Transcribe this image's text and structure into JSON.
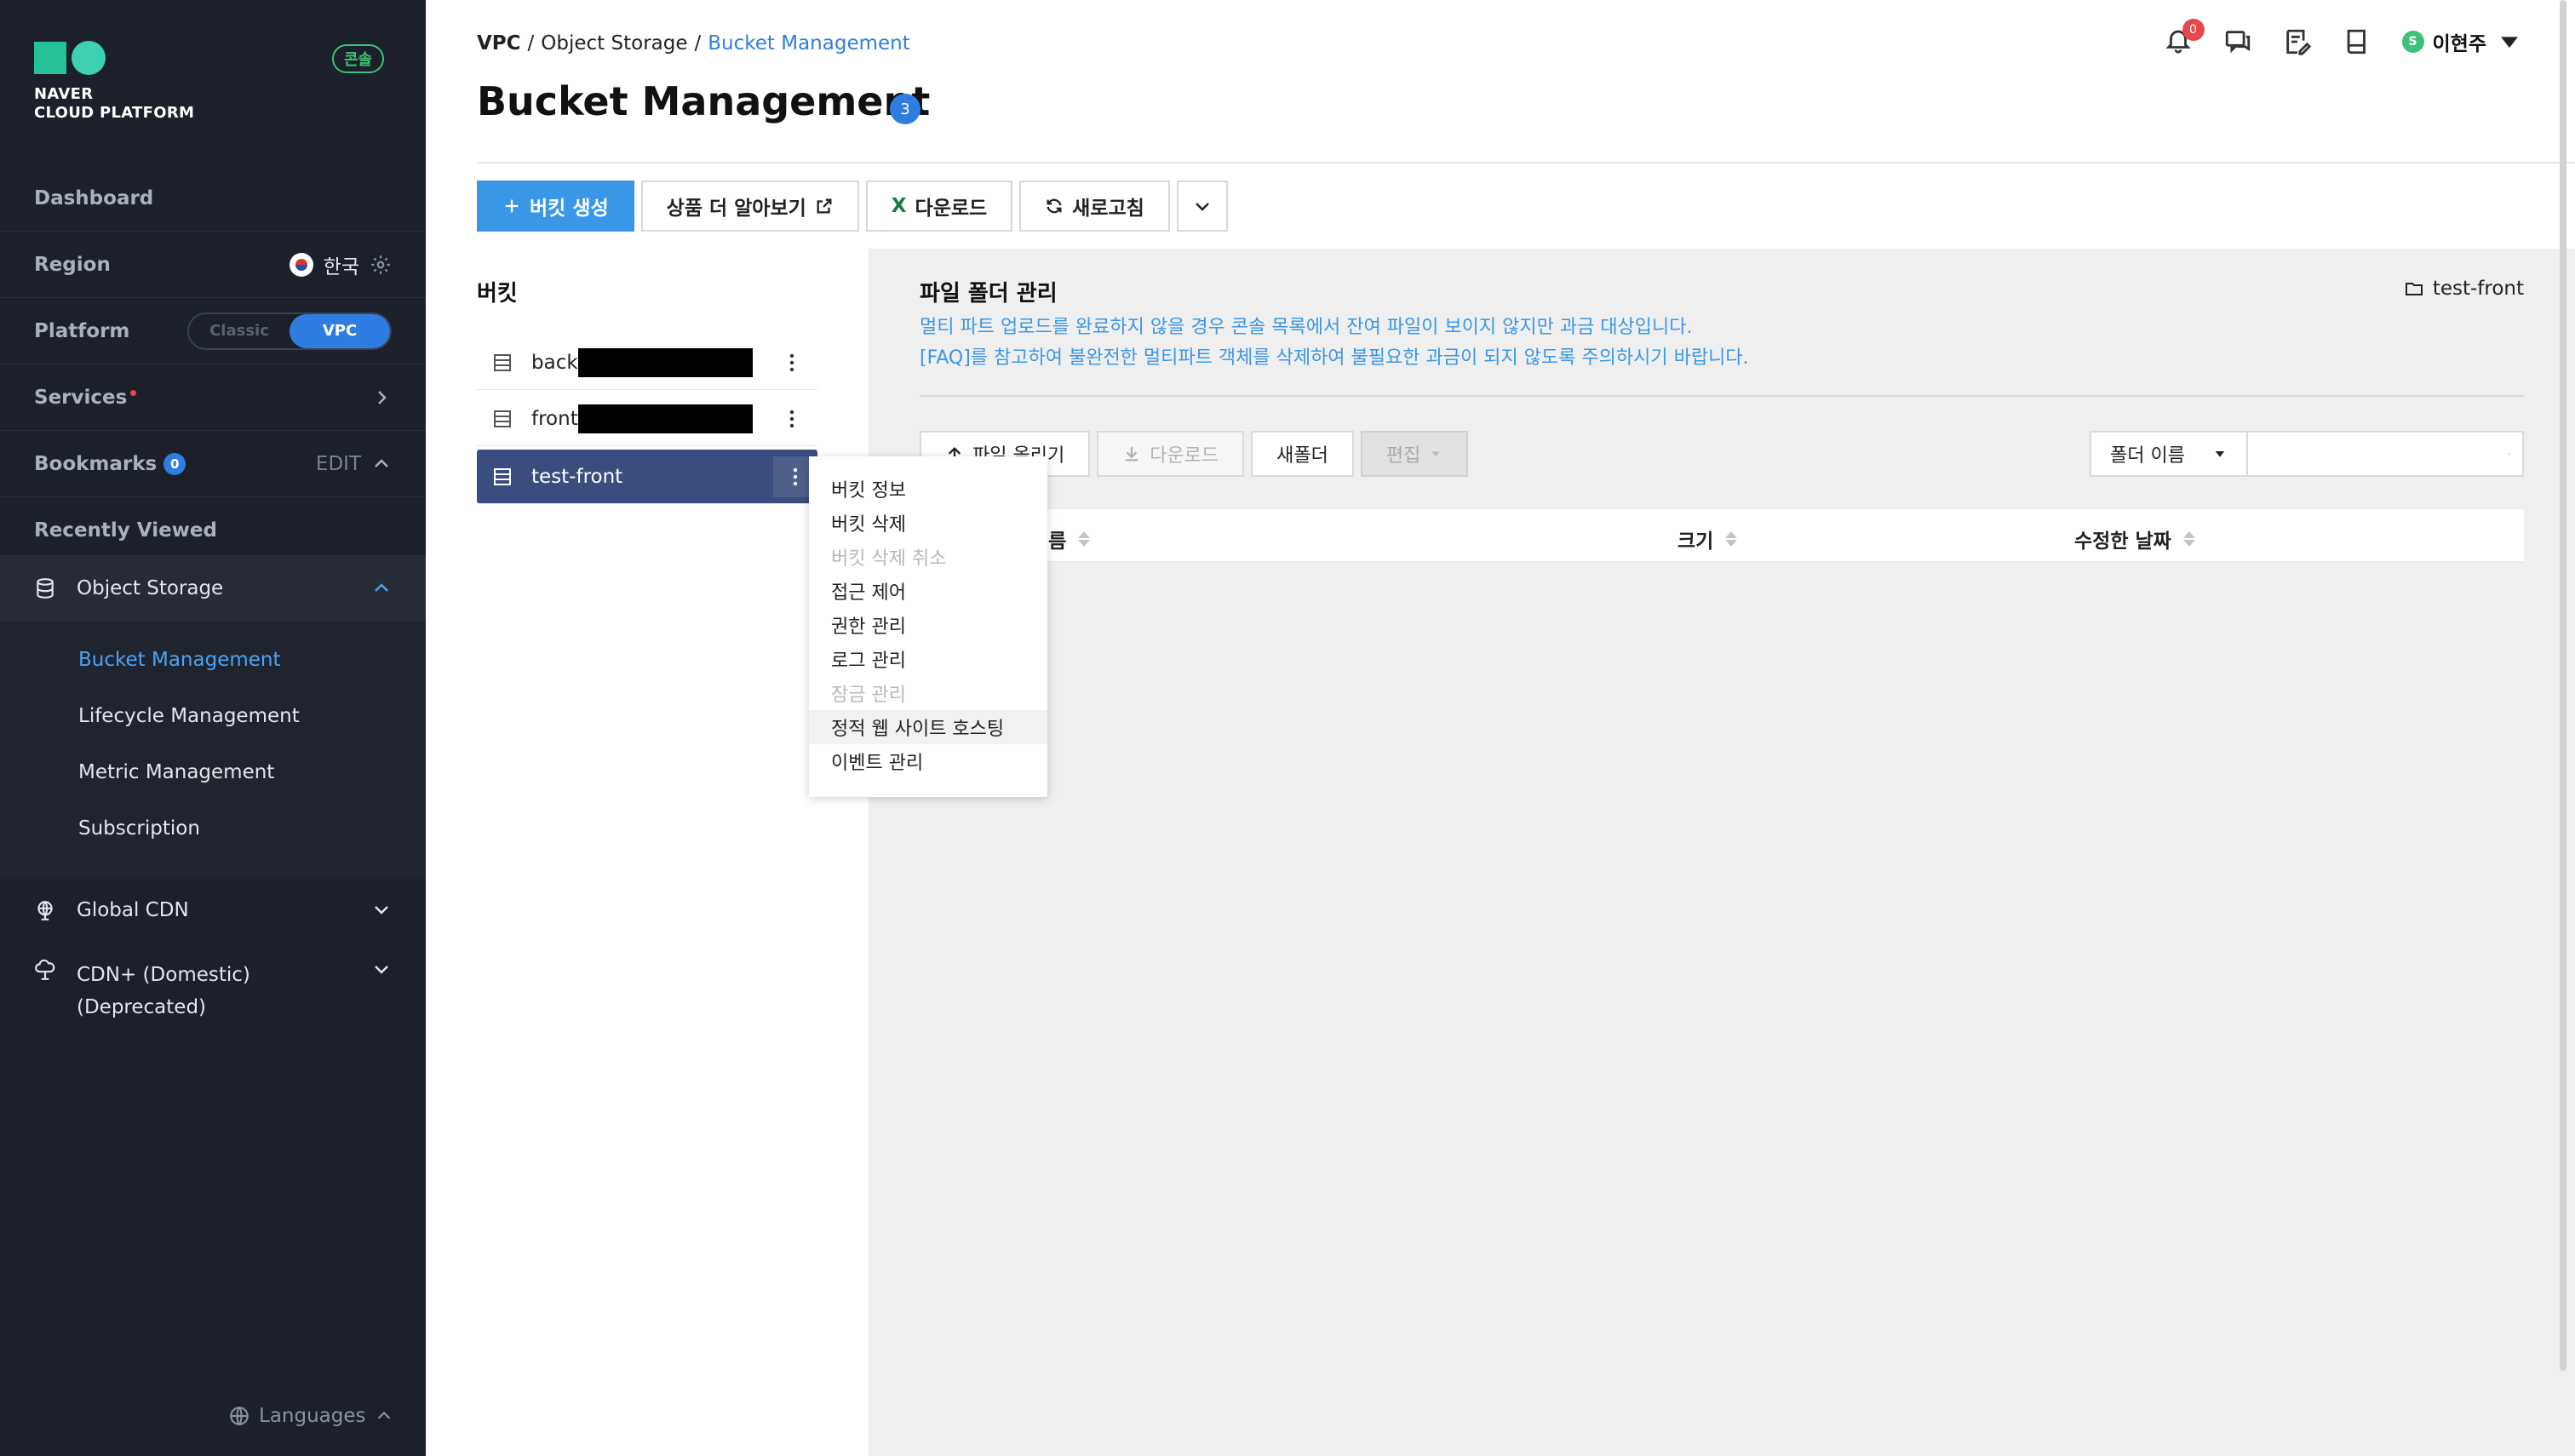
{
  "brand": {
    "logo_line1": "NAVER",
    "logo_line2": "CLOUD PLATFORM",
    "console_badge": "콘솔",
    "colors": {
      "accent": "#2f7de1",
      "logo_green": "#27c198"
    }
  },
  "sidebar": {
    "dashboard": "Dashboard",
    "region_label": "Region",
    "region_value": "한국",
    "platform_label": "Platform",
    "platform_options": [
      "Classic",
      "VPC"
    ],
    "platform_selected": "VPC",
    "services_label": "Services",
    "bookmarks_label": "Bookmarks",
    "bookmarks_count": "0",
    "bookmarks_edit": "EDIT",
    "recently_viewed": "Recently Viewed",
    "object_storage": "Object Storage",
    "sub_items": [
      "Bucket Management",
      "Lifecycle Management",
      "Metric Management",
      "Subscription"
    ],
    "global_cdn": "Global CDN",
    "cdn_plus_line1": "CDN+ (Domestic)",
    "cdn_plus_line2": "(Deprecated)",
    "languages": "Languages"
  },
  "header": {
    "breadcrumb": [
      "VPC",
      "Object Storage",
      "Bucket Management"
    ],
    "title": "Bucket Management",
    "title_count": "3",
    "notifications_count": "0",
    "user_initial": "S",
    "user_name": "이현주"
  },
  "toolbar": {
    "create_bucket": "버킷 생성",
    "learn_more": "상품 더 알아보기",
    "download": "다운로드",
    "refresh": "새로고침"
  },
  "buckets": {
    "heading": "버킷",
    "items": [
      {
        "name": "back",
        "redacted": true
      },
      {
        "name": "front",
        "redacted": true
      },
      {
        "name": "test-front",
        "redacted": false,
        "selected": true
      }
    ]
  },
  "context_menu": {
    "items": [
      {
        "label": "버킷 정보",
        "disabled": false
      },
      {
        "label": "버킷 삭제",
        "disabled": false
      },
      {
        "label": "버킷 삭제 취소",
        "disabled": true
      },
      {
        "label": "접근 제어",
        "disabled": false
      },
      {
        "label": "권한 관리",
        "disabled": false
      },
      {
        "label": "로그 관리",
        "disabled": false
      },
      {
        "label": "잠금 관리",
        "disabled": true
      },
      {
        "label": "정적 웹 사이트 호스팅",
        "disabled": false,
        "hover": true
      },
      {
        "label": "이벤트 관리",
        "disabled": false
      }
    ]
  },
  "file_manager": {
    "title": "파일 폴더 관리",
    "current_folder": "test-front",
    "notice_line1": "멀티 파트 업로드를 완료하지 않을 경우 콘솔 목록에서 잔여 파일이 보이지 않지만 과금 대상입니다.",
    "notice_line2": "[FAQ]를 참고하여 불완전한 멀티파트 객체를 삭제하여 불필요한 과금이 되지 않도록 주의하시기 바랍니다.",
    "upload": "파일 올리기",
    "download": "다운로드",
    "new_folder": "새폴더",
    "edit": "편집",
    "filter_select": "폴더 이름",
    "search_placeholder": "",
    "columns": [
      "이름",
      "크기",
      "수정한 날짜"
    ]
  }
}
